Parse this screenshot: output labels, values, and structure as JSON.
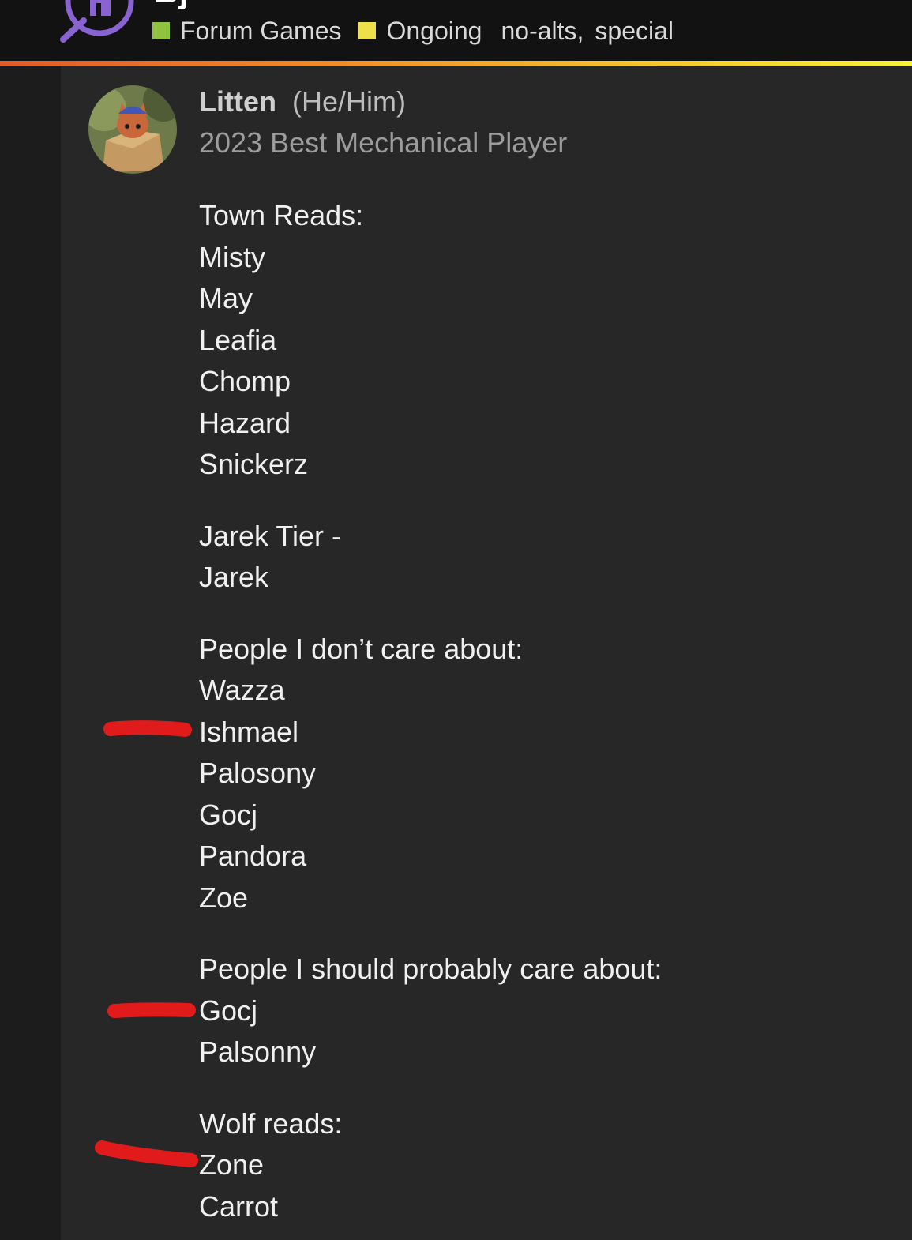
{
  "header": {
    "title": "Bj",
    "categories": [
      {
        "label": "Forum Games",
        "color": "#8fc23e"
      },
      {
        "label": "Ongoing",
        "color": "#ede04a"
      }
    ],
    "tags": [
      "no-alts",
      "special"
    ],
    "tag_separator": ","
  },
  "post": {
    "author": "Litten",
    "pronouns": "(He/Him)",
    "user_title": "2023 Best Mechanical Player",
    "sections": [
      {
        "lines": [
          "Town Reads:",
          "Misty",
          "May",
          "Leafia",
          "Chomp",
          "Hazard",
          "Snickerz"
        ]
      },
      {
        "lines": [
          "Jarek Tier -",
          "Jarek"
        ]
      },
      {
        "lines": [
          "People I don’t care about:",
          "Wazza",
          "Ishmael",
          "Palosony",
          "Gocj",
          "Pandora",
          "Zoe"
        ]
      },
      {
        "lines": [
          "People I should probably care about:",
          "Gocj",
          "Palsonny"
        ]
      },
      {
        "lines": [
          "Wolf reads:",
          "Zone",
          "Carrot"
        ]
      }
    ]
  },
  "annotation_color": "#e11b1b"
}
